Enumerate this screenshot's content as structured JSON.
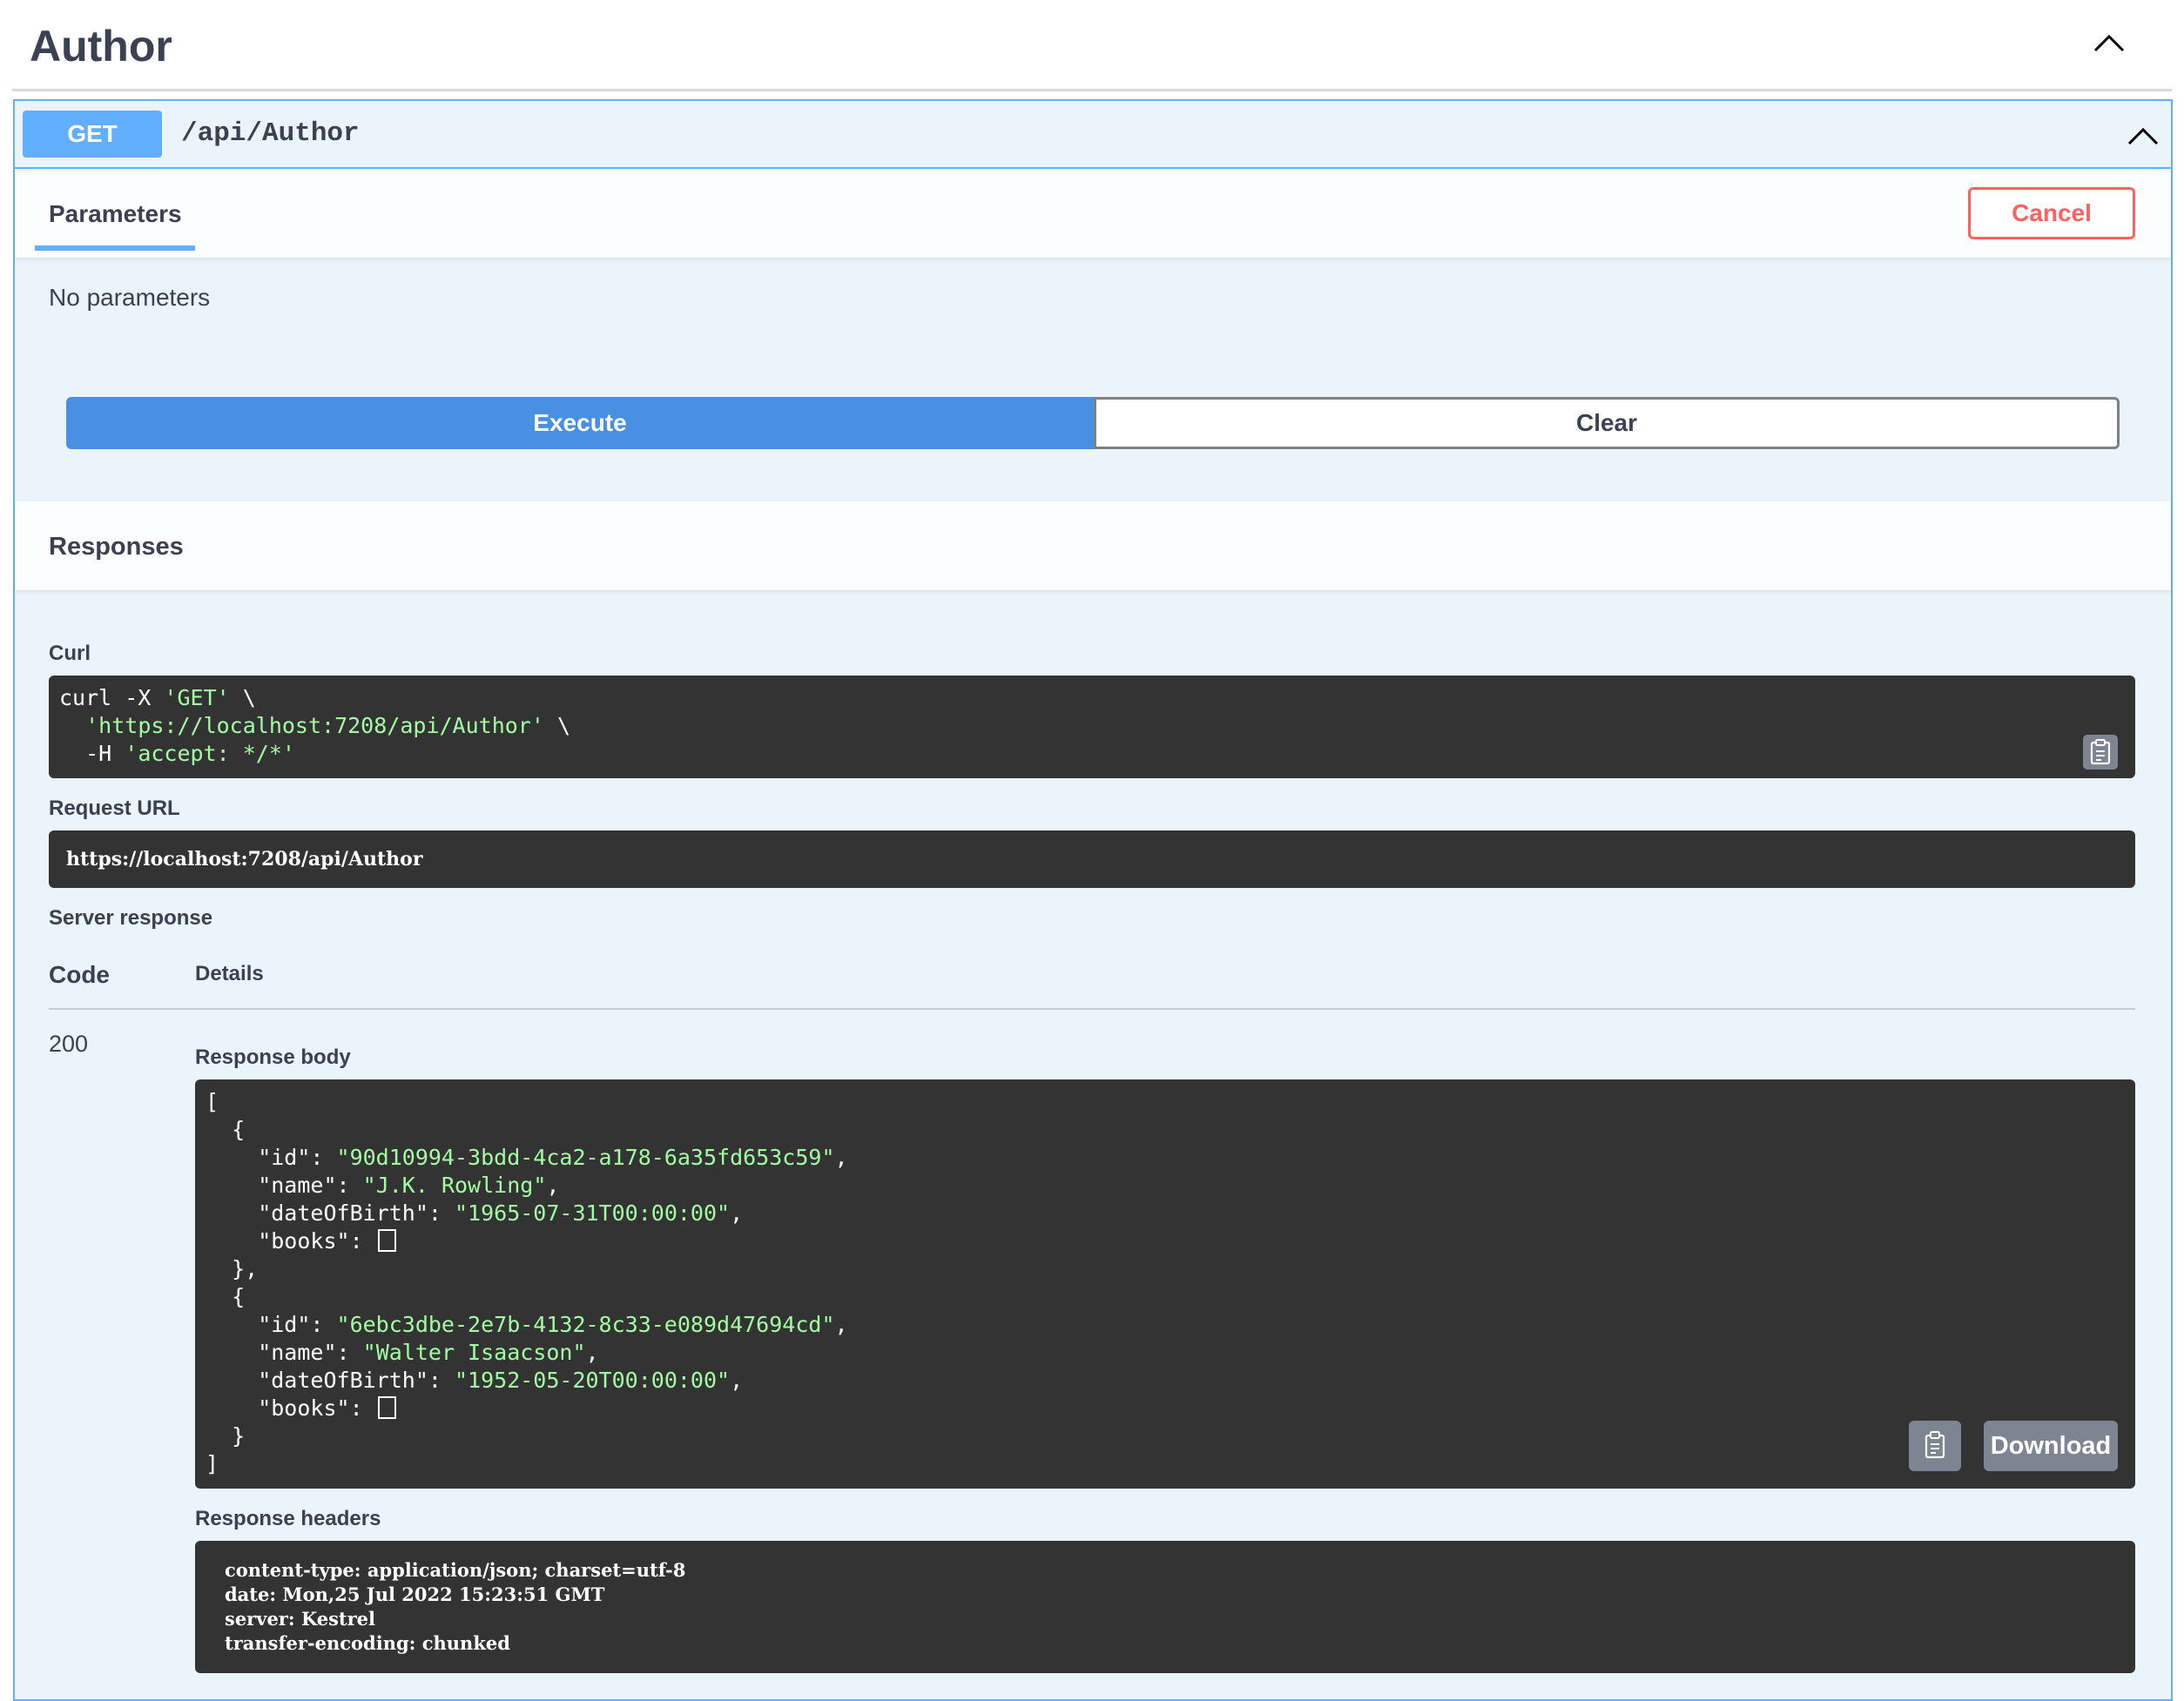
{
  "tag": {
    "title": "Author"
  },
  "operation": {
    "method": "GET",
    "path": "/api/Author"
  },
  "parameters": {
    "tab_label": "Parameters",
    "cancel_label": "Cancel",
    "empty_text": "No parameters"
  },
  "actions": {
    "execute_label": "Execute",
    "clear_label": "Clear"
  },
  "responses": {
    "title": "Responses",
    "curl": {
      "label": "Curl",
      "line1_prefix": "curl -X ",
      "line1_method": "'GET'",
      "line1_suffix": " \\",
      "line2_url": "'https://localhost:7208/api/Author'",
      "line2_suffix": " \\",
      "line3_prefix": "-H ",
      "line3_header": "'accept: */*'"
    },
    "request_url": {
      "label": "Request URL",
      "value": "https://localhost:7208/api/Author"
    },
    "server_response": {
      "label": "Server response",
      "code_header": "Code",
      "details_header": "Details",
      "code": "200",
      "body_label": "Response body",
      "download_label": "Download",
      "body": [
        {
          "id": "90d10994-3bdd-4ca2-a178-6a35fd653c59",
          "name": "J.K. Rowling",
          "dateOfBirth": "1965-07-31T00:00:00"
        },
        {
          "id": "6ebc3dbe-2e7b-4132-8c33-e089d47694cd",
          "name": "Walter Isaacson",
          "dateOfBirth": "1952-05-20T00:00:00"
        }
      ],
      "headers_label": "Response headers",
      "headers": [
        "content-type: application/json; charset=utf-8",
        "date: Mon,25 Jul 2022 15:23:51 GMT",
        "server: Kestrel",
        "transfer-encoding: chunked"
      ]
    }
  },
  "icons": {
    "collapse_tag": "chevron-up-icon",
    "collapse_operation": "chevron-up-icon",
    "copy": "clipboard-icon"
  },
  "colors": {
    "get_accent": "#61affe",
    "execute": "#4990e2",
    "cancel": "#ff6060",
    "code_bg": "#333333",
    "string": "#a2fca2"
  }
}
